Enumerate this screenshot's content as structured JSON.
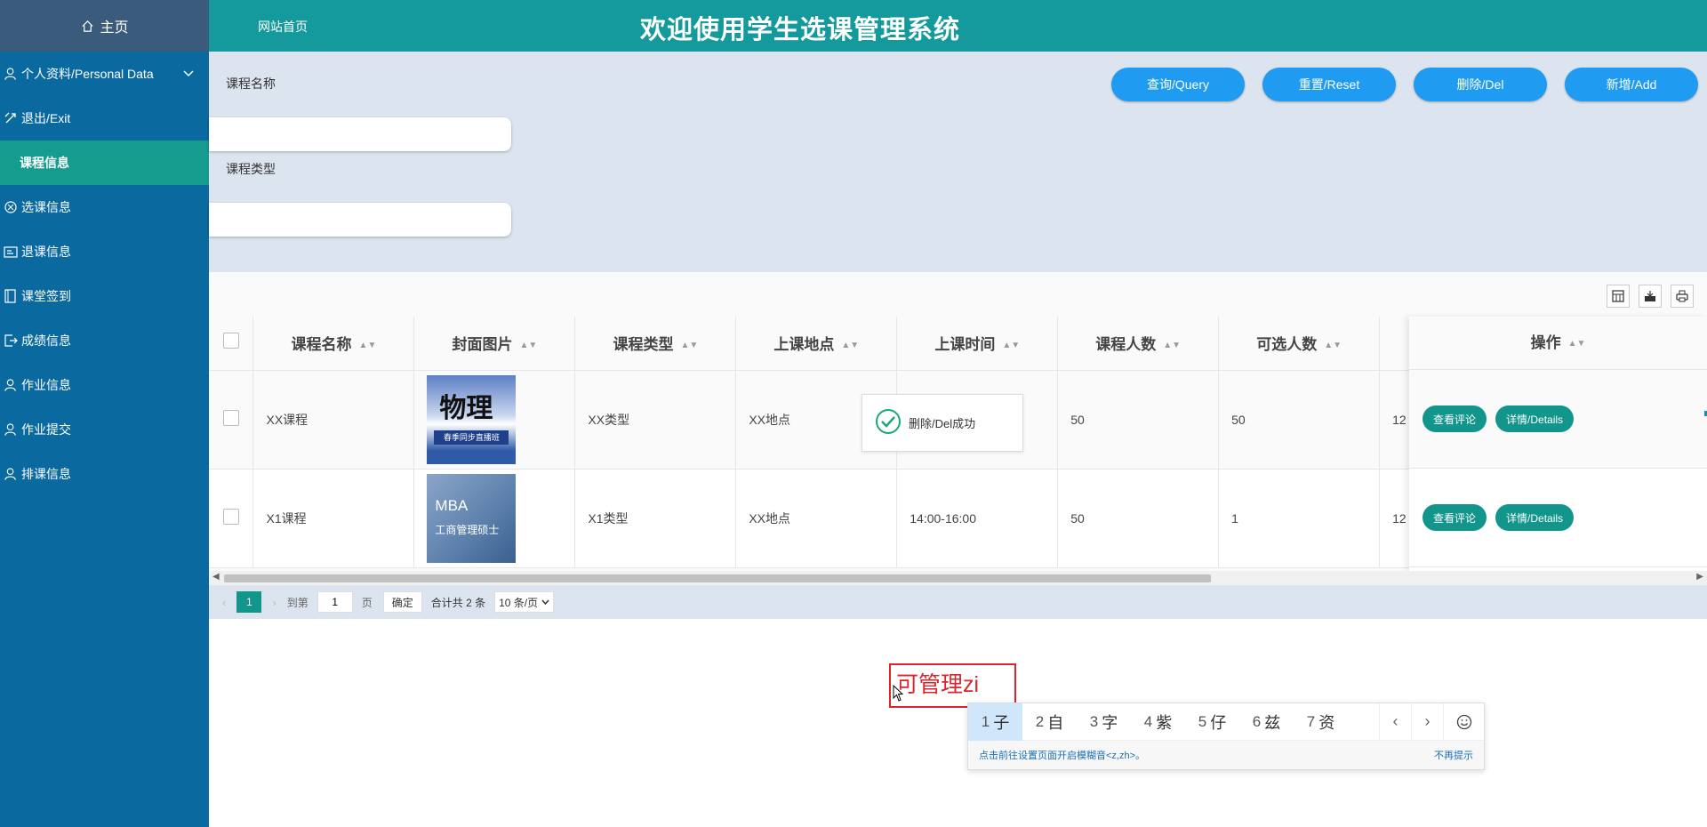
{
  "sidebar": {
    "home": "主页",
    "items": [
      {
        "label": "个人资料/Personal Data"
      },
      {
        "label": "退出/Exit"
      },
      {
        "label": "课程信息"
      },
      {
        "label": "选课信息"
      },
      {
        "label": "退课信息"
      },
      {
        "label": "课堂签到"
      },
      {
        "label": "成绩信息"
      },
      {
        "label": "作业信息"
      },
      {
        "label": "作业提交"
      },
      {
        "label": "排课信息"
      }
    ]
  },
  "header": {
    "home_link": "网站首页",
    "title": "欢迎使用学生选课管理系统"
  },
  "search": {
    "field1_label": "课程名称",
    "field1_value": "",
    "field2_label": "课程类型",
    "field2_value": "",
    "buttons": {
      "query": "查询/Query",
      "reset": "重置/Reset",
      "delete": "删除/Del",
      "add": "新增/Add"
    }
  },
  "table": {
    "columns": [
      "课程名称",
      "封面图片",
      "课程类型",
      "上课地点",
      "上课时间",
      "课程人数",
      "可选人数"
    ],
    "ops_header": "操作",
    "rows": [
      {
        "name": "XX课程",
        "cover": "物理",
        "cover_band": "春季同步直播班",
        "type": "XX类型",
        "location": "XX地点",
        "time": "",
        "capacity": "50",
        "available": "50",
        "extra": "12"
      },
      {
        "name": "X1课程",
        "cover": "MBA",
        "cover_sub": "工商管理硕士",
        "type": "X1类型",
        "location": "XX地点",
        "time": "14:00-16:00",
        "capacity": "50",
        "available": "1",
        "extra": "12"
      }
    ],
    "row_buttons": {
      "comments": "查看评论",
      "details": "详情/Details"
    }
  },
  "pager": {
    "current": "1",
    "goto_label": "到第",
    "goto_value": "1",
    "page_suffix": "页",
    "confirm": "确定",
    "total": "合计共 2 条",
    "page_size": "10 条/页"
  },
  "toast": {
    "message": "删除/Del成功"
  },
  "ime": {
    "composition": "可管理zi",
    "candidates": [
      {
        "n": "1",
        "c": "子"
      },
      {
        "n": "2",
        "c": "自"
      },
      {
        "n": "3",
        "c": "字"
      },
      {
        "n": "4",
        "c": "紫"
      },
      {
        "n": "5",
        "c": "仔"
      },
      {
        "n": "6",
        "c": "兹"
      },
      {
        "n": "7",
        "c": "资"
      }
    ],
    "hint": "点击前往设置页面开启模糊音<z,zh>。",
    "dismiss": "不再提示"
  },
  "colors": {
    "sidebar": "#0a6aa0",
    "header": "#149a9c",
    "active_menu": "#159c8e",
    "primary_button": "#1f9cf2",
    "green_button": "#12958a"
  }
}
